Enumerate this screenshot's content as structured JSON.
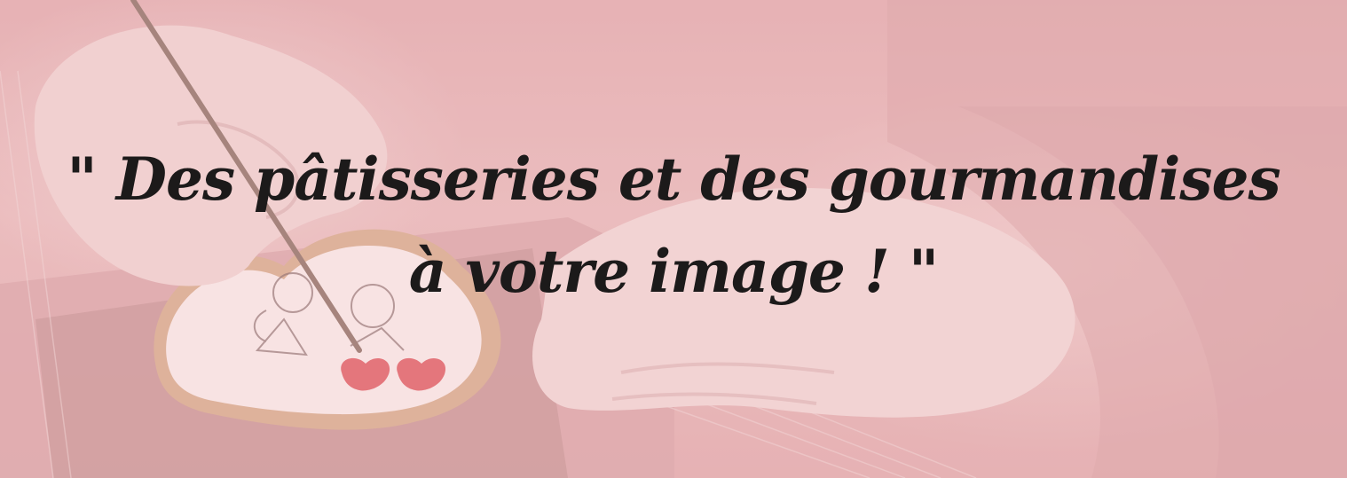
{
  "banner": {
    "quote_line_1": "\" Des pâtisseries et des gourmandises",
    "quote_line_2": "à votre image ! \""
  },
  "colors": {
    "background_pink": "#e6b3b6",
    "text": "#1c1a1a",
    "icing_white": "#fbeeee",
    "cookie_edge": "#d7a98a",
    "heart_red": "#e0575f",
    "mesh_mat": "#b98786"
  }
}
